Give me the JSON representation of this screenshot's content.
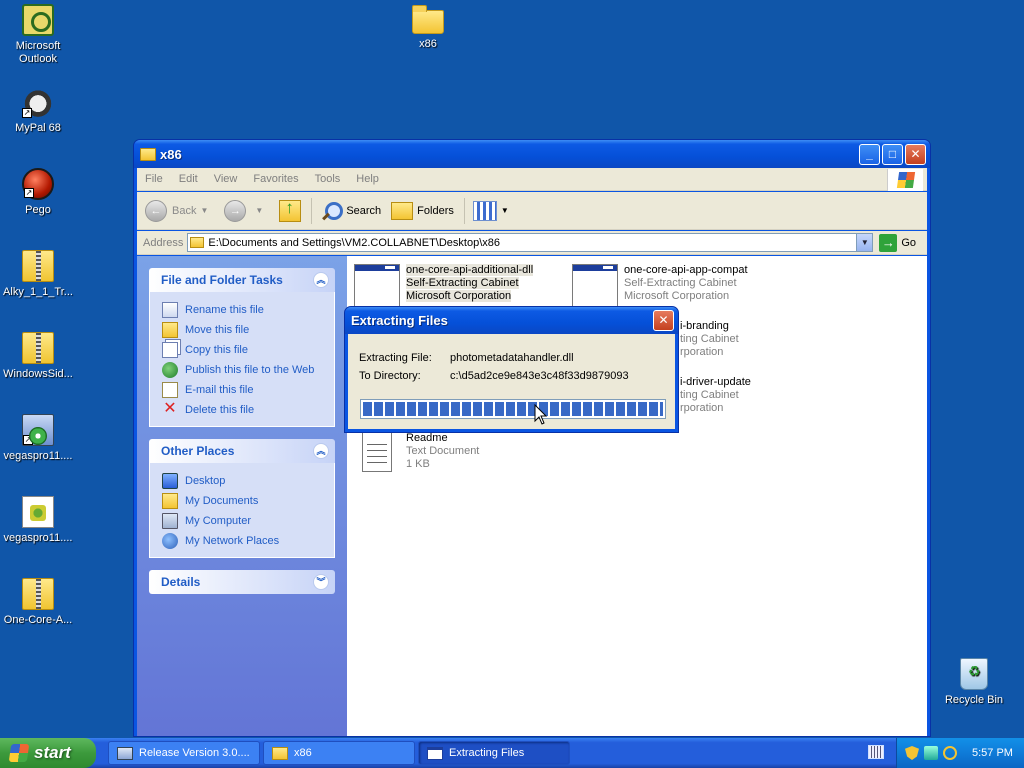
{
  "desktop": {
    "icons": [
      {
        "label": "Microsoft Outlook",
        "icon": "outlook-icon"
      },
      {
        "label": "x86",
        "icon": "folder-icon"
      },
      {
        "label": "MyPal 68",
        "icon": "mypal-icon"
      },
      {
        "label": "Pego",
        "icon": "pego-icon"
      },
      {
        "label": "Alky_1_1_Tr...",
        "icon": "zip-icon"
      },
      {
        "label": "WindowsSid...",
        "icon": "zip-icon"
      },
      {
        "label": "vegaspro11....",
        "icon": "setup-icon"
      },
      {
        "label": "vegaspro11....",
        "icon": "installer-icon"
      },
      {
        "label": "One-Core-A...",
        "icon": "zip-icon"
      },
      {
        "label": "Recycle Bin",
        "icon": "recycle-bin-icon"
      }
    ]
  },
  "explorer": {
    "title": "x86",
    "menu": [
      "File",
      "Edit",
      "View",
      "Favorites",
      "Tools",
      "Help"
    ],
    "toolbar": {
      "back": "Back",
      "search": "Search",
      "folders": "Folders"
    },
    "address": {
      "label": "Address",
      "value": "E:\\Documents and Settings\\VM2.COLLABNET\\Desktop\\x86",
      "go": "Go"
    },
    "file_folder_tasks": {
      "title": "File and Folder Tasks",
      "items": [
        "Rename this file",
        "Move this file",
        "Copy this file",
        "Publish this file to the Web",
        "E-mail this file",
        "Delete this file"
      ]
    },
    "other_places": {
      "title": "Other Places",
      "items": [
        "Desktop",
        "My Documents",
        "My Computer",
        "My Network Places"
      ]
    },
    "details": {
      "title": "Details"
    },
    "files": [
      {
        "name": "one-core-api-additional-dll",
        "type": "Self-Extracting Cabinet",
        "company": "Microsoft Corporation"
      },
      {
        "name": "one-core-api-app-compat",
        "type": "Self-Extracting Cabinet",
        "company": "Microsoft Corporation"
      },
      {
        "name": "i-branding",
        "type": "ting Cabinet",
        "company": "rporation"
      },
      {
        "name": "i-driver-update",
        "type": "ting Cabinet",
        "company": "rporation"
      },
      {
        "name": "Readme",
        "type": "Text Document",
        "company": "1 KB"
      }
    ]
  },
  "extract_dialog": {
    "title": "Extracting Files",
    "file_label": "Extracting File:",
    "file_value": "photometadatahandler.dll",
    "dir_label": "To Directory:",
    "dir_value": "c:\\d5ad2ce9e843e3c48f33d9879093",
    "progress": 1.0
  },
  "taskbar": {
    "start": "start",
    "items": [
      "Release Version 3.0....",
      "x86",
      "Extracting Files"
    ],
    "clock": "5:57 PM"
  }
}
